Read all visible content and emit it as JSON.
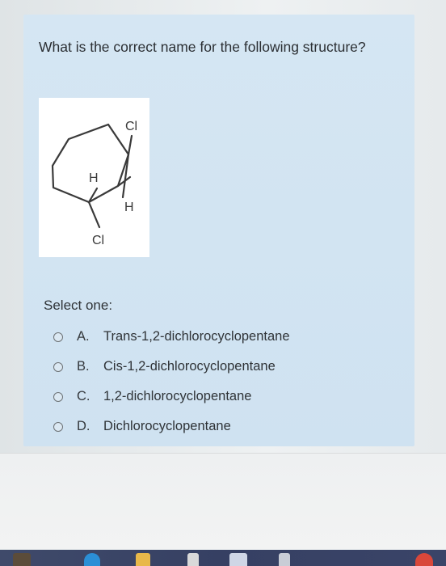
{
  "question": {
    "text": "What is the correct name for the following structure?"
  },
  "structure": {
    "labels": {
      "cl_top": "Cl",
      "h_left": "H",
      "h_right": "H",
      "cl_bottom": "Cl"
    }
  },
  "answer": {
    "prompt": "Select one:",
    "options": [
      {
        "letter": "A.",
        "text": "Trans-1,2-dichlorocyclopentane"
      },
      {
        "letter": "B.",
        "text": "Cis-1,2-dichlorocyclopentane"
      },
      {
        "letter": "C.",
        "text": "1,2-dichlorocyclopentane"
      },
      {
        "letter": "D.",
        "text": "Dichlorocyclopentane"
      }
    ]
  },
  "taskbar": {
    "icons": [
      "app-icon",
      "edge-icon",
      "file-explorer-icon",
      "store-icon",
      "mail-icon",
      "app-icon",
      "chrome-icon"
    ]
  }
}
